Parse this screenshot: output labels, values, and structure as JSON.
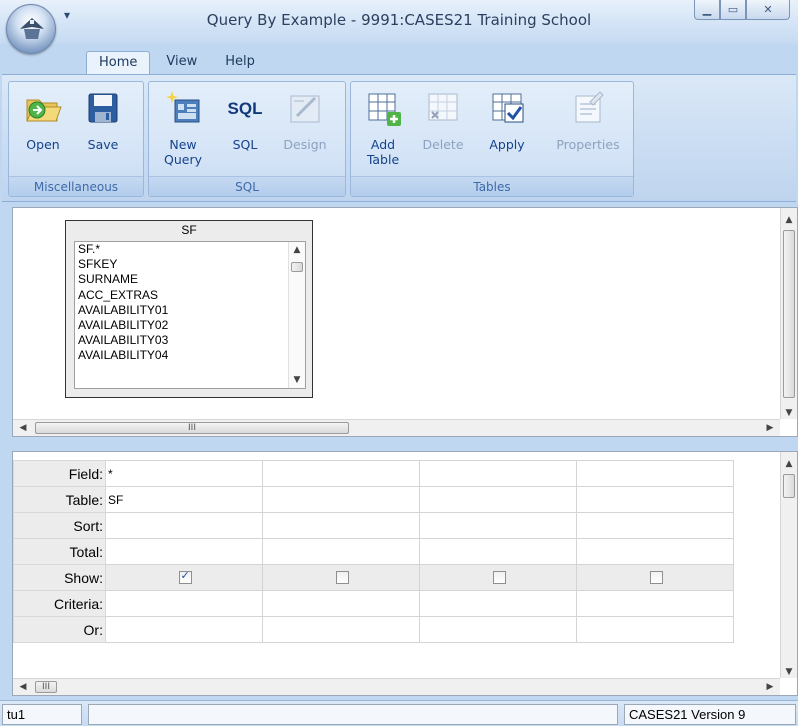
{
  "window": {
    "title": "Query By Example - 9991:CASES21 Training School",
    "qat_icon": "dropdown-arrow",
    "controls": [
      "minimize",
      "maximize",
      "close"
    ]
  },
  "tabs": [
    "Home",
    "View",
    "Help"
  ],
  "ribbon": {
    "groups": [
      {
        "label": "Miscellaneous",
        "buttons": [
          {
            "label": "Open",
            "icon": "folder-open-icon"
          },
          {
            "label": "Save",
            "icon": "floppy-disk-icon"
          }
        ]
      },
      {
        "label": "SQL",
        "buttons": [
          {
            "label": "New Query",
            "icon": "new-query-icon"
          },
          {
            "label": "SQL",
            "icon": "sql-text-icon"
          },
          {
            "label": "Design",
            "icon": "design-icon",
            "disabled": true
          }
        ]
      },
      {
        "label": "Tables",
        "buttons": [
          {
            "label": "Add Table",
            "icon": "add-table-icon"
          },
          {
            "label": "Delete",
            "icon": "delete-table-icon",
            "disabled": true
          },
          {
            "label": "Apply",
            "icon": "apply-table-icon"
          },
          {
            "label": "Properties",
            "icon": "properties-icon",
            "disabled": true
          }
        ]
      }
    ]
  },
  "design": {
    "table": {
      "name": "SF",
      "fields": [
        "SF.*",
        "SFKEY",
        "SURNAME",
        "ACC_EXTRAS",
        "AVAILABILITY01",
        "AVAILABILITY02",
        "AVAILABILITY03",
        "AVAILABILITY04"
      ]
    }
  },
  "grid": {
    "row_labels": [
      "Field:",
      "Table:",
      "Sort:",
      "Total:",
      "Show:",
      "Criteria:",
      "Or:"
    ],
    "columns": [
      {
        "field": "*",
        "table": "SF",
        "show": true
      },
      {
        "field": "",
        "table": "",
        "show": false
      },
      {
        "field": "",
        "table": "",
        "show": false
      },
      {
        "field": "",
        "table": "",
        "show": false
      }
    ]
  },
  "status": {
    "left": "tu1",
    "middle": "",
    "right": "CASES21 Version 9"
  },
  "colors": {
    "ribbon_bg": "#c9dcf2",
    "accent_text": "#15428b",
    "group_label": "#3e6aaa"
  }
}
